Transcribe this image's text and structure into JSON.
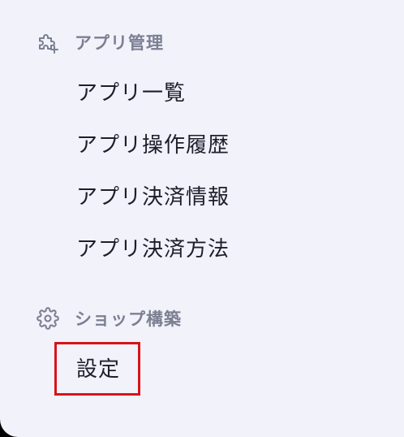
{
  "sections": [
    {
      "icon": "puzzle-plus-icon",
      "title": "アプリ管理",
      "items": [
        {
          "label": "アプリ一覧"
        },
        {
          "label": "アプリ操作履歴"
        },
        {
          "label": "アプリ決済情報"
        },
        {
          "label": "アプリ決済方法"
        }
      ]
    },
    {
      "icon": "gear-icon",
      "title": "ショップ構築",
      "items": [
        {
          "label": "設定",
          "highlighted": true
        }
      ]
    }
  ],
  "colors": {
    "panel_bg": "#f1f2fa",
    "header_text": "#7b7f92",
    "item_text": "#1d1f2a",
    "highlight_border": "#d7141a"
  }
}
